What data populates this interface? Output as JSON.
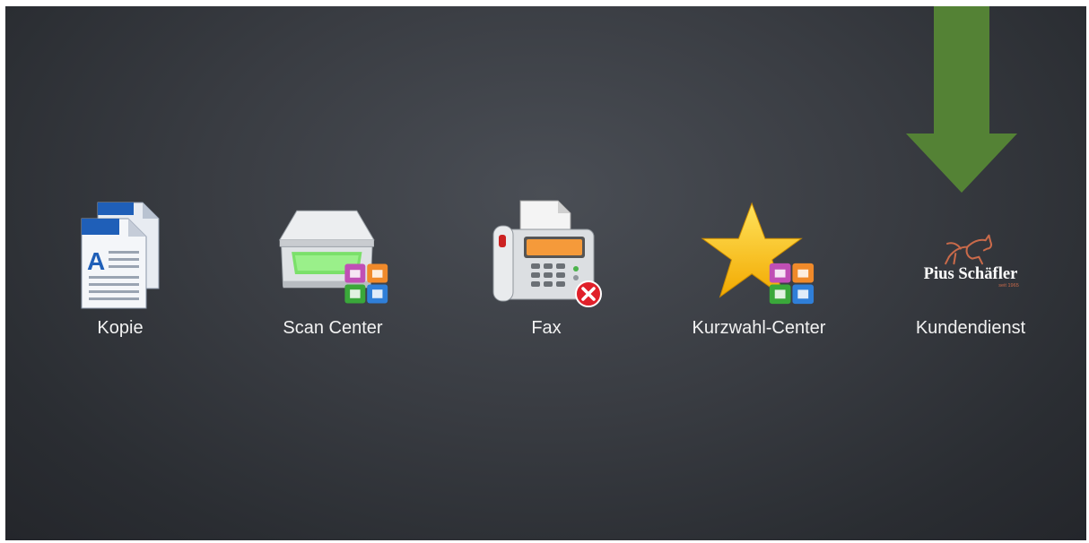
{
  "apps": [
    {
      "label": "Kopie",
      "icon": "copy-document-icon"
    },
    {
      "label": "Scan Center",
      "icon": "scanner-icon"
    },
    {
      "label": "Fax",
      "icon": "fax-machine-icon"
    },
    {
      "label": "Kurzwahl-Center",
      "icon": "star-shortcut-icon"
    },
    {
      "label": "Kundendienst",
      "icon": "pius-schaefler-logo"
    }
  ],
  "brand": {
    "name": "Pius Schäfler",
    "tagline": "seit 1965"
  },
  "colors": {
    "arrow": "#548235",
    "background": "#393c42",
    "label": "#f2f2f2",
    "brand_accent": "#c96a4a",
    "fax_error": "#e0202a"
  }
}
